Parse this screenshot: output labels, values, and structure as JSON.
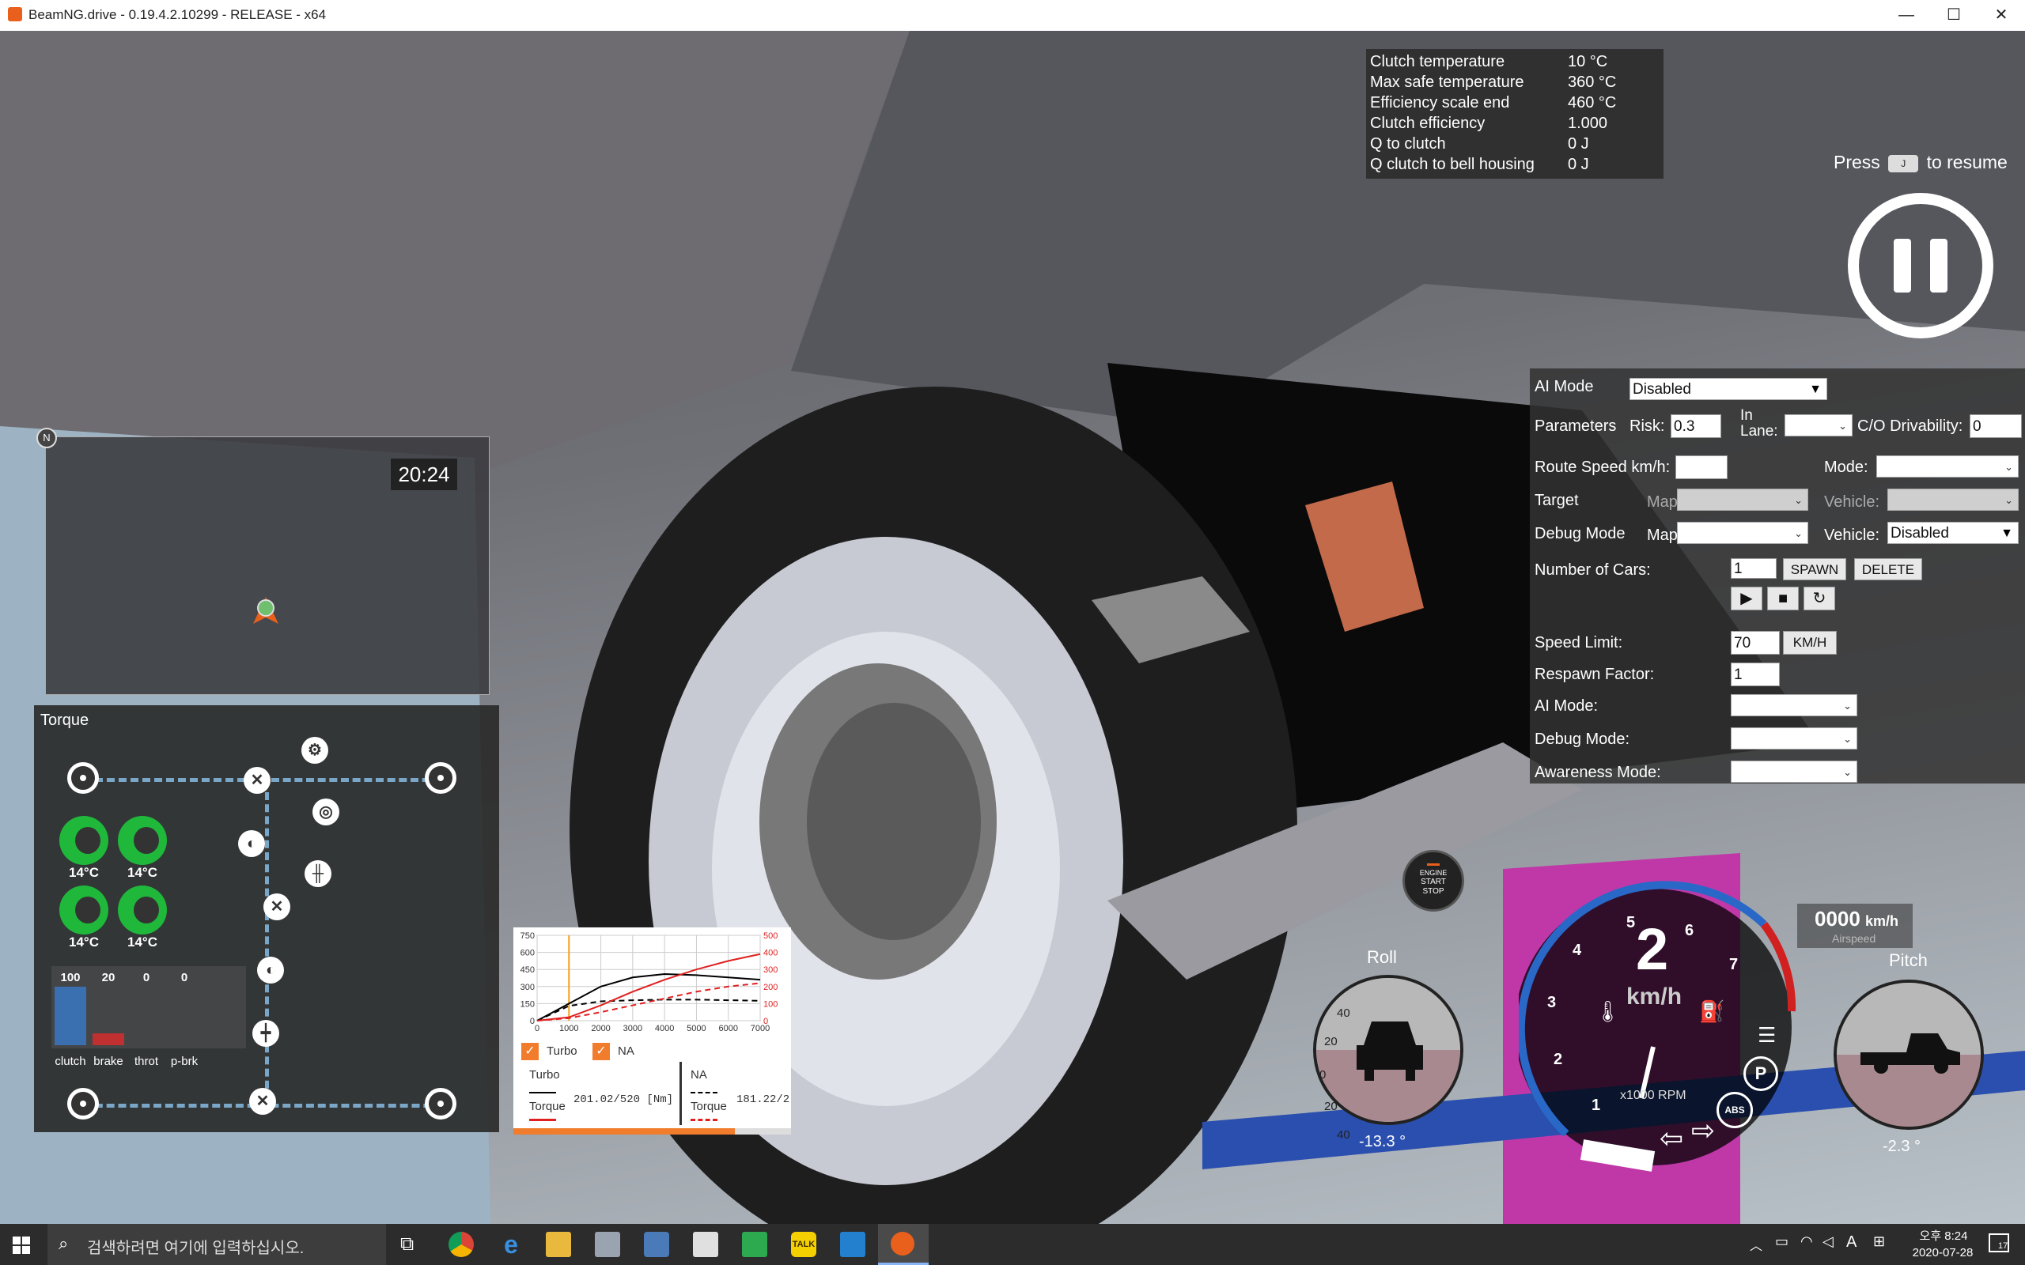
{
  "window": {
    "title": "BeamNG.drive - 0.19.4.2.10299 - RELEASE - x64",
    "minimize": "—",
    "maximize": "☐",
    "close": "✕"
  },
  "clutch_panel": {
    "rows": [
      {
        "label": "Clutch temperature",
        "value": "10 °C"
      },
      {
        "label": "Max safe temperature",
        "value": "360 °C"
      },
      {
        "label": "Efficiency scale end",
        "value": "460 °C"
      },
      {
        "label": "Clutch efficiency",
        "value": "1.000"
      },
      {
        "label": "Q to clutch",
        "value": "0 J"
      },
      {
        "label": "Q clutch to bell housing",
        "value": "0 J"
      }
    ]
  },
  "resume": {
    "press": "Press",
    "to_resume": "to resume",
    "key_hint": "J"
  },
  "ai_panel": {
    "ai_mode_label": "AI Mode",
    "ai_mode_value": "Disabled",
    "parameters_label": "Parameters",
    "risk_label": "Risk:",
    "risk_value": "0.3",
    "in_lane_label": "In Lane:",
    "co_drivability_label": "C/O Drivability:",
    "co_drivability_value": "0",
    "route_speed_label": "Route Speed km/h:",
    "route_mode_label": "Mode:",
    "target_label": "Target",
    "target_map_label": "Map:",
    "target_vehicle_label": "Vehicle:",
    "debug_mode_label": "Debug Mode",
    "debug_map_label": "Map:",
    "debug_vehicle_label": "Vehicle:",
    "debug_vehicle_value": "Disabled",
    "num_cars_label": "Number of Cars:",
    "num_cars_value": "1",
    "spawn_label": "SPAWN",
    "delete_label": "DELETE",
    "speed_limit_label": "Speed Limit:",
    "speed_limit_value": "70",
    "speed_unit": "KM/H",
    "respawn_label": "Respawn Factor:",
    "respawn_value": "1",
    "ai_mode2_label": "AI Mode:",
    "debug_mode2_label": "Debug Mode:",
    "awareness_label": "Awareness Mode:"
  },
  "minimap": {
    "time": "20:24",
    "north": "N"
  },
  "torque_panel": {
    "title": "Torque",
    "temps": [
      "14°C",
      "14°C",
      "14°C",
      "14°C"
    ],
    "bars": [
      {
        "label": "clutch",
        "value": "100",
        "fill": 1.0
      },
      {
        "label": "brake",
        "value": "20",
        "fill": 0.2
      },
      {
        "label": "throt",
        "value": "0",
        "fill": 0
      },
      {
        "label": "p-brk",
        "value": "0",
        "fill": 0
      }
    ]
  },
  "chart_data": {
    "type": "line",
    "x_ticks": [
      "0",
      "1000",
      "2000",
      "3000",
      "4000",
      "5000",
      "6000",
      "7000"
    ],
    "y_left_ticks": [
      "750",
      "600",
      "450",
      "300",
      "150",
      "0"
    ],
    "y_right_ticks": [
      "500",
      "400",
      "300",
      "200",
      "100",
      "0"
    ],
    "x": [
      0,
      1000,
      2000,
      3000,
      4000,
      5000,
      6000,
      7000
    ],
    "series": [
      {
        "name": "Turbo",
        "kind": "torque",
        "color": "#000000",
        "dash": false,
        "axis": "left",
        "values": [
          0,
          150,
          300,
          380,
          410,
          400,
          380,
          360
        ]
      },
      {
        "name": "NA",
        "kind": "torque",
        "color": "#000000",
        "dash": true,
        "axis": "left",
        "values": [
          0,
          130,
          170,
          180,
          185,
          185,
          180,
          175
        ]
      },
      {
        "name": "Turbo",
        "kind": "power",
        "color": "#e02020",
        "dash": false,
        "axis": "right",
        "values": [
          0,
          20,
          90,
          170,
          240,
          300,
          350,
          390
        ]
      },
      {
        "name": "NA",
        "kind": "power",
        "color": "#e02020",
        "dash": true,
        "axis": "right",
        "values": [
          0,
          15,
          50,
          90,
          130,
          170,
          200,
          220
        ]
      }
    ],
    "legend": [
      "Turbo",
      "NA"
    ],
    "turbo_box": {
      "title": "Turbo",
      "torque_label": "Torque",
      "torque_value": "201.02/520 [Nm]"
    },
    "na_box": {
      "title": "NA",
      "torque_label": "Torque",
      "torque_value": "181.22/2"
    }
  },
  "dashboard": {
    "engine_button": [
      "ENGINE",
      "START",
      "STOP"
    ],
    "gear": "2",
    "speed_unit": "km/h",
    "rpm_unit": "x1000 RPM",
    "rpm_ticks": [
      "1",
      "2",
      "3",
      "4",
      "5",
      "6",
      "7"
    ],
    "airspeed_value": "0000",
    "airspeed_unit": "km/h",
    "airspeed_label": "Airspeed",
    "roll_label": "Roll",
    "roll_value": "-13.3 °",
    "pitch_label": "Pitch",
    "pitch_value": "-2.3 °",
    "roll_ticks": [
      "40",
      "20",
      "0",
      "20",
      "40"
    ],
    "badges": [
      "P",
      "ABS"
    ]
  },
  "taskbar": {
    "search_placeholder": "검색하려면 여기에 입력하십시오.",
    "clock_time": "오후 8:24",
    "clock_date": "2020-07-28",
    "ime": "A",
    "notif": "17"
  }
}
